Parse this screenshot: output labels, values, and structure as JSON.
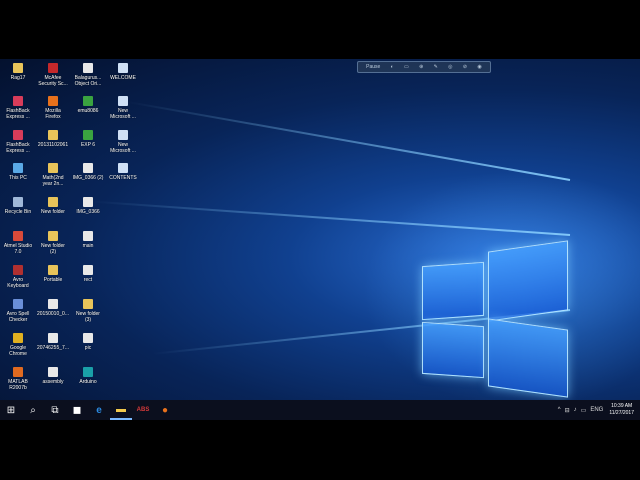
{
  "desktop": {
    "icons": [
      {
        "label": "Rag17",
        "icon": "folder-icon",
        "color": "#e8c45a"
      },
      {
        "label": "McAfee\nSecurity Sc...",
        "icon": "mcafee-icon",
        "color": "#c4282b"
      },
      {
        "label": "Balagurus...\nObject Ori...",
        "icon": "document-icon",
        "color": "#e8e8e8"
      },
      {
        "label": "WELCOME",
        "icon": "document-icon",
        "color": "#cfe0f5"
      },
      {
        "label": "FlashBack\nExpress ...",
        "icon": "flashback-icon",
        "color": "#d83c5a"
      },
      {
        "label": "Mozilla\nFirefox",
        "icon": "firefox-icon",
        "color": "#e8711c"
      },
      {
        "label": "emu8086",
        "icon": "emu-icon",
        "color": "#3aa340"
      },
      {
        "label": "New\nMicrosoft ...",
        "icon": "document-icon",
        "color": "#cfe0f5"
      },
      {
        "label": "FlashBack\nExpress ...",
        "icon": "flashback-icon",
        "color": "#d83c5a"
      },
      {
        "label": "20131102061",
        "icon": "folder-icon",
        "color": "#e8c45a"
      },
      {
        "label": "EXP 6",
        "icon": "emu-icon",
        "color": "#3aa340"
      },
      {
        "label": "New\nMicrosoft ...",
        "icon": "document-icon",
        "color": "#cfe0f5"
      },
      {
        "label": "This PC",
        "icon": "computer-icon",
        "color": "#5aa9e6"
      },
      {
        "label": "Math(2nd\nyear 2n...",
        "icon": "folder-icon",
        "color": "#e8c45a"
      },
      {
        "label": "IMG_0366 (2)",
        "icon": "document-icon",
        "color": "#e8e8e8"
      },
      {
        "label": "CONTENTS",
        "icon": "document-icon",
        "color": "#cfe0f5"
      },
      {
        "label": "Recycle Bin",
        "icon": "recycle-bin-icon",
        "color": "#9fb8d8"
      },
      {
        "label": "New folder",
        "icon": "folder-icon",
        "color": "#e8c45a"
      },
      {
        "label": "IMG_0366",
        "icon": "document-icon",
        "color": "#e8e8e8"
      },
      {
        "label": "Atmel Studio\n7.0",
        "icon": "atmel-icon",
        "color": "#d84a3a"
      },
      {
        "label": "New folder\n(2)",
        "icon": "folder-icon",
        "color": "#e8c45a"
      },
      {
        "label": "main",
        "icon": "document-icon",
        "color": "#e8e8e8"
      },
      {
        "label": "Avro\nKeyboard",
        "icon": "avro-icon",
        "color": "#b03030"
      },
      {
        "label": "Portable",
        "icon": "folder-icon",
        "color": "#e8c45a"
      },
      {
        "label": "rect",
        "icon": "document-icon",
        "color": "#e8e8e8"
      },
      {
        "label": "Avro Spell\nChecker",
        "icon": "avro-spell-icon",
        "color": "#6a8fd8"
      },
      {
        "label": "20150010_0...",
        "icon": "document-icon",
        "color": "#e8e8e8"
      },
      {
        "label": "New folder\n(3)",
        "icon": "folder-icon",
        "color": "#e8c45a"
      },
      {
        "label": "Google\nChrome",
        "icon": "chrome-icon",
        "color": "#e0b020"
      },
      {
        "label": "20746255_7...",
        "icon": "document-icon",
        "color": "#e8e8e8"
      },
      {
        "label": "pic",
        "icon": "document-icon",
        "color": "#e8e8e8"
      },
      {
        "label": "MATLAB\nR2007b",
        "icon": "matlab-icon",
        "color": "#e06a20"
      },
      {
        "label": "assembly",
        "icon": "document-icon",
        "color": "#e8e8e8"
      },
      {
        "label": "Arduino",
        "icon": "arduino-icon",
        "color": "#1aa0a8"
      }
    ]
  },
  "recorder_toolbar": {
    "label": "Pause",
    "buttons": [
      "◐",
      "▭",
      "⊕",
      "✎",
      "◎",
      "⊘",
      "◉"
    ]
  },
  "taskbar": {
    "start": "⊞",
    "search": "⌕",
    "task_view": "⧉",
    "apps": [
      {
        "name": "store",
        "glyph": "◼",
        "color": "#ffffff"
      },
      {
        "name": "edge",
        "glyph": "e",
        "color": "#2b8ae0"
      },
      {
        "name": "file-explorer",
        "glyph": "▬",
        "color": "#f2c94c"
      },
      {
        "name": "abs",
        "glyph": "ABS",
        "color": "#d63a3a"
      },
      {
        "name": "firefox",
        "glyph": "●",
        "color": "#e8711c"
      }
    ],
    "tray_icons": [
      "^",
      "⊟",
      "♪",
      "▭",
      "ENG"
    ],
    "time": "10:39 AM",
    "date": "11/27/2017"
  }
}
